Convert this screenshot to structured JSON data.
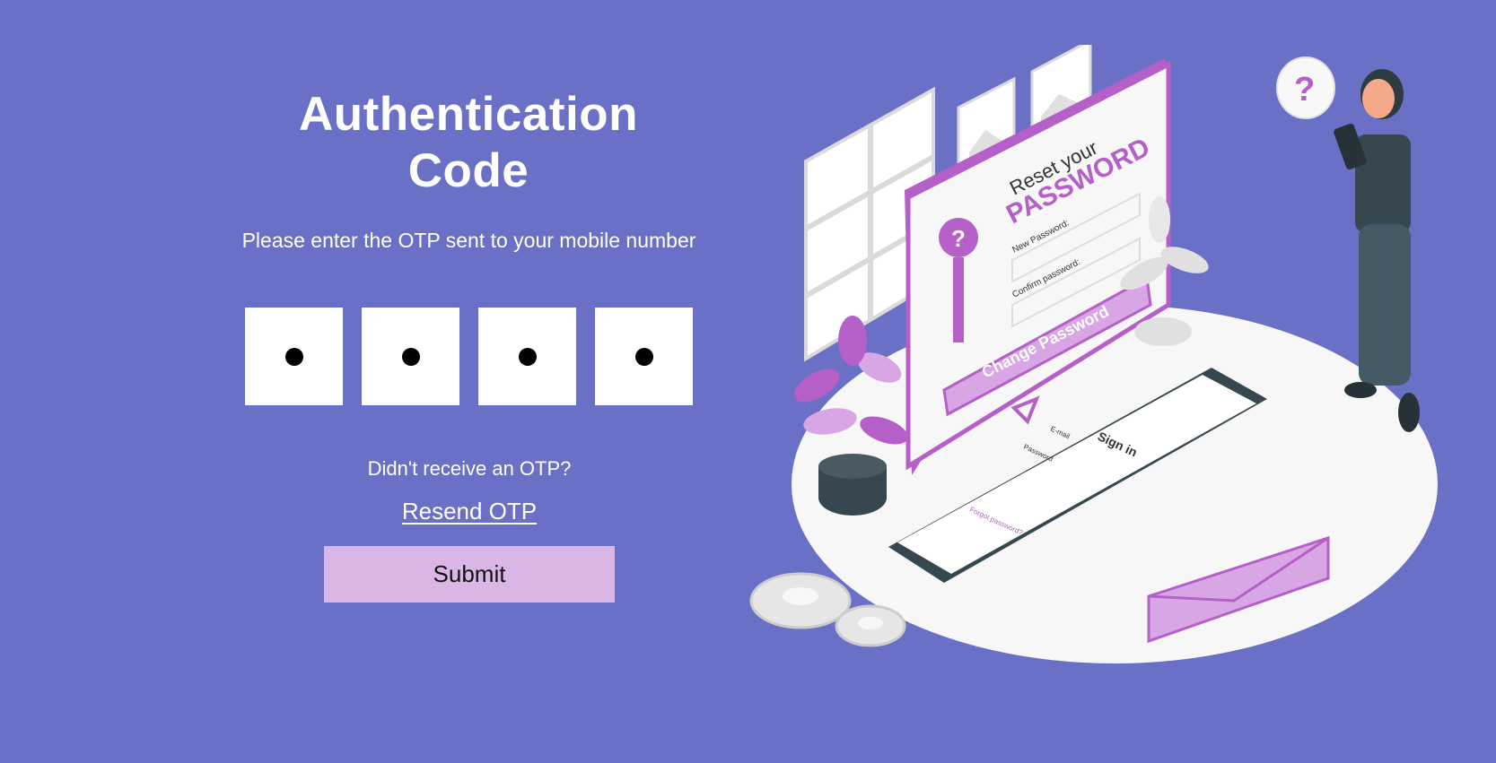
{
  "colors": {
    "background": "#6A70C5",
    "submit_bg": "#DAB6E6",
    "accent_purple": "#B55FC8",
    "light_purple": "#D8A6E5"
  },
  "auth": {
    "title_line1": "Authentication",
    "title_line2": "Code",
    "subtitle": "Please enter the OTP sent to your mobile number",
    "otp_digits": 4,
    "prompt": "Didn't receive an OTP?",
    "resend_label": "Resend OTP",
    "submit_label": "Submit"
  },
  "illustration": {
    "card_heading_1": "Reset your",
    "card_heading_2": "PASSWORD",
    "new_password_label": "New Password:",
    "confirm_password_label": "Confirm password:",
    "change_button": "Change Password",
    "phone_title": "Sign in",
    "phone_email_label": "E-mail",
    "phone_password_label": "Password",
    "phone_forgot": "Forgot password?",
    "question_mark": "?"
  }
}
